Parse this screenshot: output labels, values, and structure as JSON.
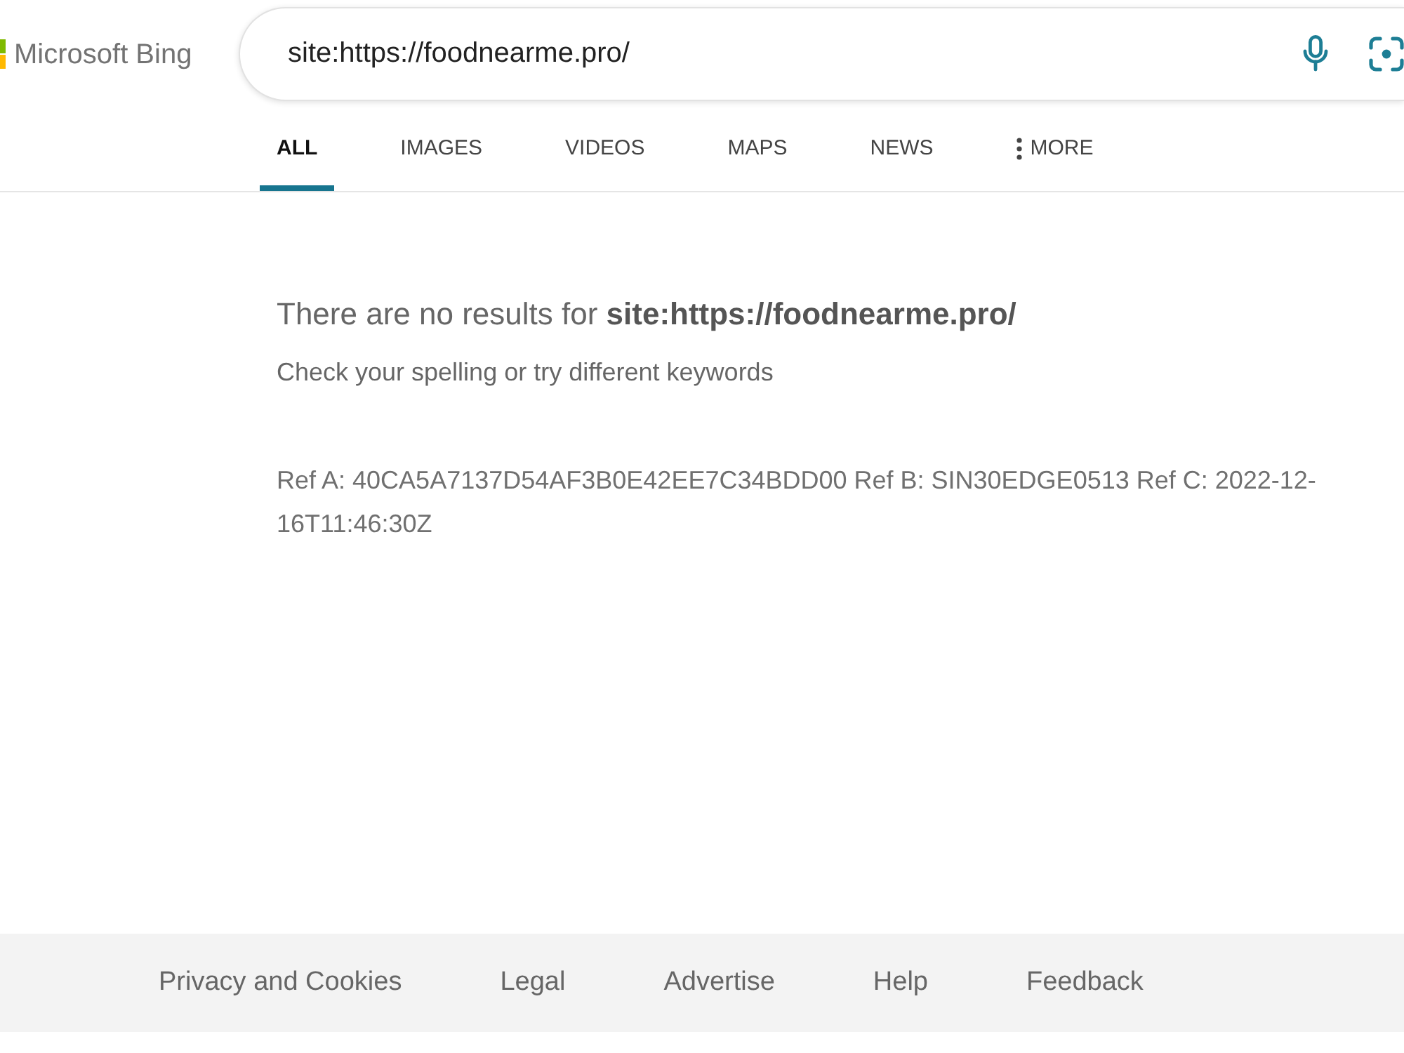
{
  "header": {
    "logo_text": "Microsoft Bing",
    "search": {
      "value": "site:https://foodnearme.pro/"
    }
  },
  "tabs": [
    {
      "label": "ALL",
      "selected": true,
      "kind": "link"
    },
    {
      "label": "IMAGES",
      "selected": false,
      "kind": "link"
    },
    {
      "label": "VIDEOS",
      "selected": false,
      "kind": "link"
    },
    {
      "label": "MAPS",
      "selected": false,
      "kind": "link"
    },
    {
      "label": "NEWS",
      "selected": false,
      "kind": "link"
    },
    {
      "label": "MORE",
      "selected": false,
      "kind": "menu"
    }
  ],
  "results": {
    "message": "There are no results for **site:https://foodnearme.pro/**",
    "hint": "Check your spelling or try different keywords",
    "reference": "Ref A: 40CA5A7137D54AF3B0E42EE7C34BDD00 Ref B: SIN30EDGE0513 Ref C: 2022-12-16T11:46:30Z"
  },
  "footer": {
    "links": [
      "Privacy and Cookies",
      "Legal",
      "Advertise",
      "Help",
      "Feedback"
    ]
  }
}
